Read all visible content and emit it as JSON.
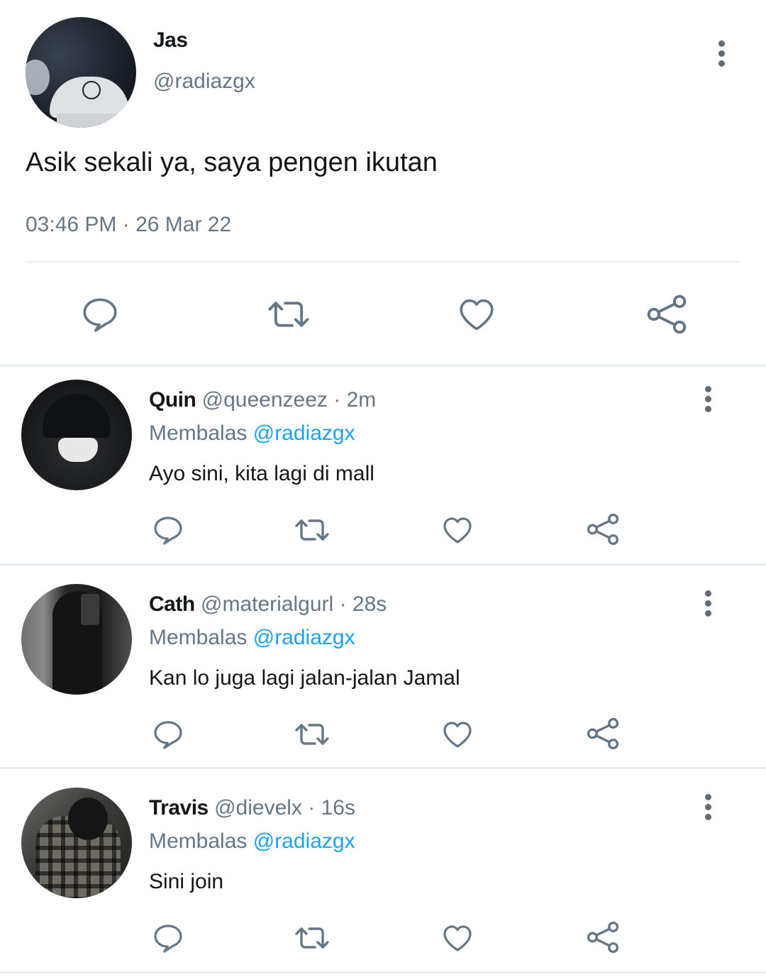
{
  "main_tweet": {
    "name": "Jas",
    "handle": "@radiazgx",
    "text": "Asik sekali ya, saya pengen ikutan",
    "timestamp": "03:46 PM · 26 Mar 22",
    "avatar_icon": "avatar-bucket-hat"
  },
  "actions": {
    "reply_icon": "speech-bubble-icon",
    "retweet_icon": "retweet-icon",
    "like_icon": "heart-icon",
    "share_icon": "share-icon",
    "color": "#657786"
  },
  "colors": {
    "text_primary": "#14171a",
    "text_secondary": "#657786",
    "mention": "#1da1f2",
    "divider": "#e6ecf0"
  },
  "replies": [
    {
      "name": "Quin",
      "handle": "@queenzeez",
      "separator": "·",
      "time": "2m",
      "replying_label": "Membalas",
      "replying_to": "@radiazgx",
      "text": "Ayo sini, kita lagi di mall"
    },
    {
      "name": "Cath",
      "handle": "@materialgurl",
      "separator": "·",
      "time": "28s",
      "replying_label": "Membalas",
      "replying_to": "@radiazgx",
      "text": "Kan lo juga lagi jalan-jalan Jamal"
    },
    {
      "name": "Travis",
      "handle": "@dievelx",
      "separator": "·",
      "time": "16s",
      "replying_label": "Membalas",
      "replying_to": "@radiazgx",
      "text": "Sini join"
    }
  ]
}
